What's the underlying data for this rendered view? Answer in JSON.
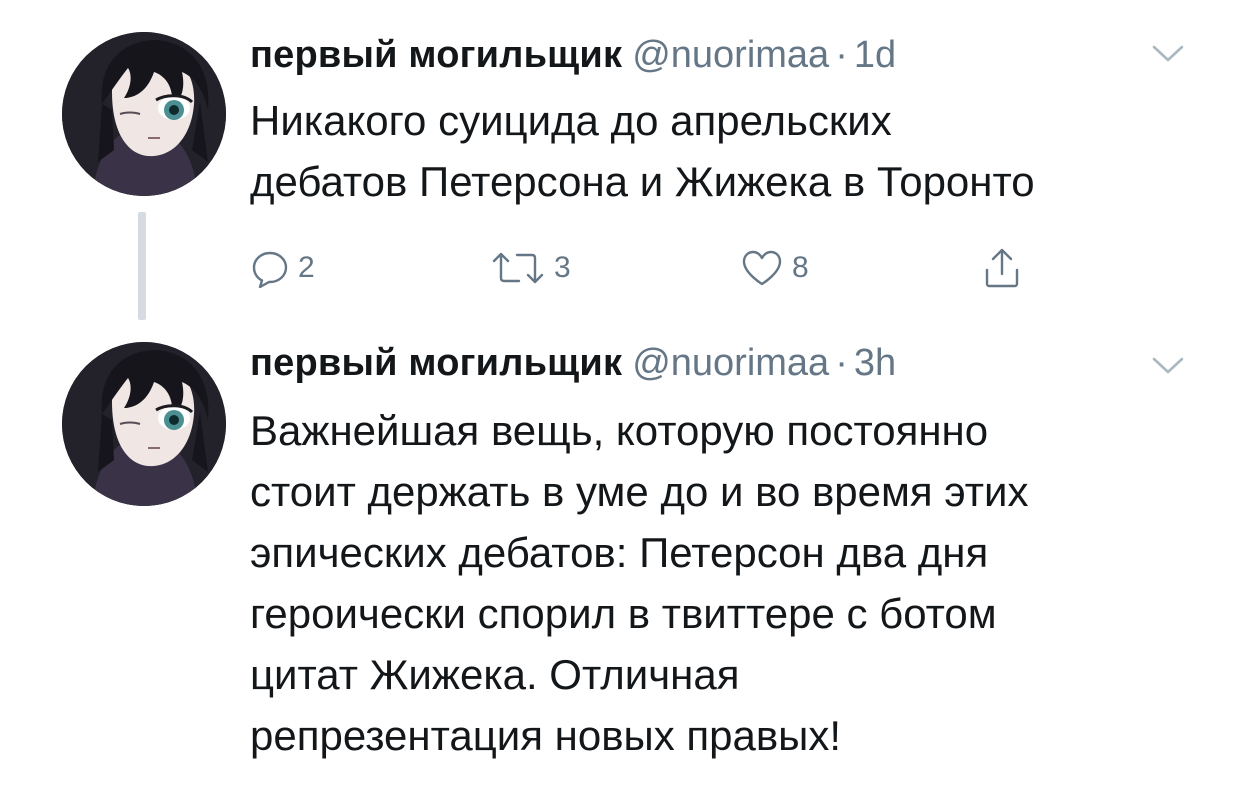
{
  "tweets": [
    {
      "display_name": "первый могильщик",
      "handle": "@nuorimaa",
      "separator": "·",
      "time": "1d",
      "text": "Никакого суицида до апрельских\nдебатов Петерсона и Жижека в Торонто",
      "actions": {
        "reply_icon": "reply-icon",
        "reply_count": "2",
        "retweet_icon": "retweet-icon",
        "retweet_count": "3",
        "like_icon": "heart-icon",
        "like_count": "8",
        "share_icon": "share-icon"
      }
    },
    {
      "display_name": "первый могильщик",
      "handle": "@nuorimaa",
      "separator": "·",
      "time": "3h",
      "text": "Важнейшая вещь, которую постоянно\nстоит держать в уме до и во время этих\nэпических дебатов: Петерсон два дня\nгероически спорил в твиттере с ботом\nцитат Жижека. Отличная\nрепрезентация новых правых!"
    }
  ],
  "colors": {
    "text_primary": "#14171a",
    "text_secondary": "#657786",
    "thread_line": "#d5dbe0",
    "background": "#ffffff"
  }
}
